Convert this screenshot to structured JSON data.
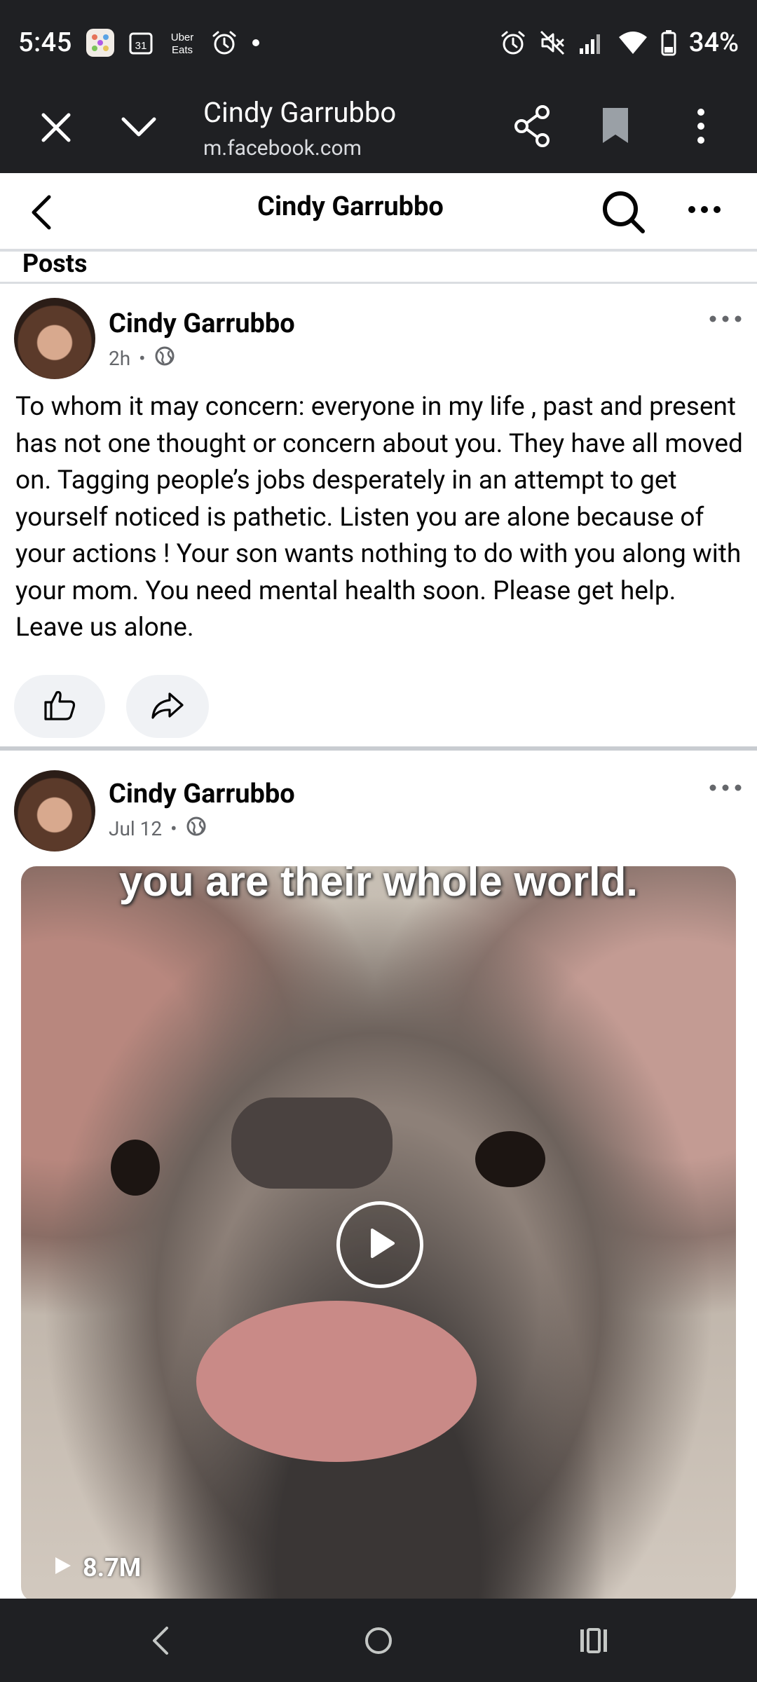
{
  "status_bar": {
    "time": "5:45",
    "battery": "34%",
    "left_icons": [
      "photos-icon",
      "calendar-icon",
      "uber-eats-icon",
      "alarm-icon",
      "dot-icon"
    ],
    "calendar_day": "31",
    "uber_eats_label": "Uber Eats",
    "right_icons": [
      "alarm-icon",
      "mute-icon",
      "signal-icon",
      "wifi-icon",
      "battery-icon"
    ]
  },
  "browser": {
    "page_title": "Cindy Garrubbo",
    "url": "m.facebook.com"
  },
  "fb_header": {
    "title": "Cindy Garrubbo"
  },
  "section": {
    "label": "Posts"
  },
  "posts": [
    {
      "author": "Cindy Garrubbo",
      "time": "2h",
      "text": "To whom it may concern: everyone in my life  , past and present has not one thought or concern about you. They have all moved on. Tagging people’s jobs desperately in an attempt to get yourself noticed is pathetic. Listen you are alone because of your actions ! Your son wants nothing to do with you along with your mom. You need mental health soon. Please get help. Leave us alone."
    },
    {
      "author": "Cindy Garrubbo",
      "time": "Jul 12",
      "media_caption": "you are their whole world.",
      "views": "8.7M"
    }
  ],
  "colors": {
    "system_bar": "#1f2023",
    "text_primary": "#050505",
    "text_secondary": "#65676b",
    "button_bg": "#f0f2f5",
    "divider": "#dadde1"
  }
}
